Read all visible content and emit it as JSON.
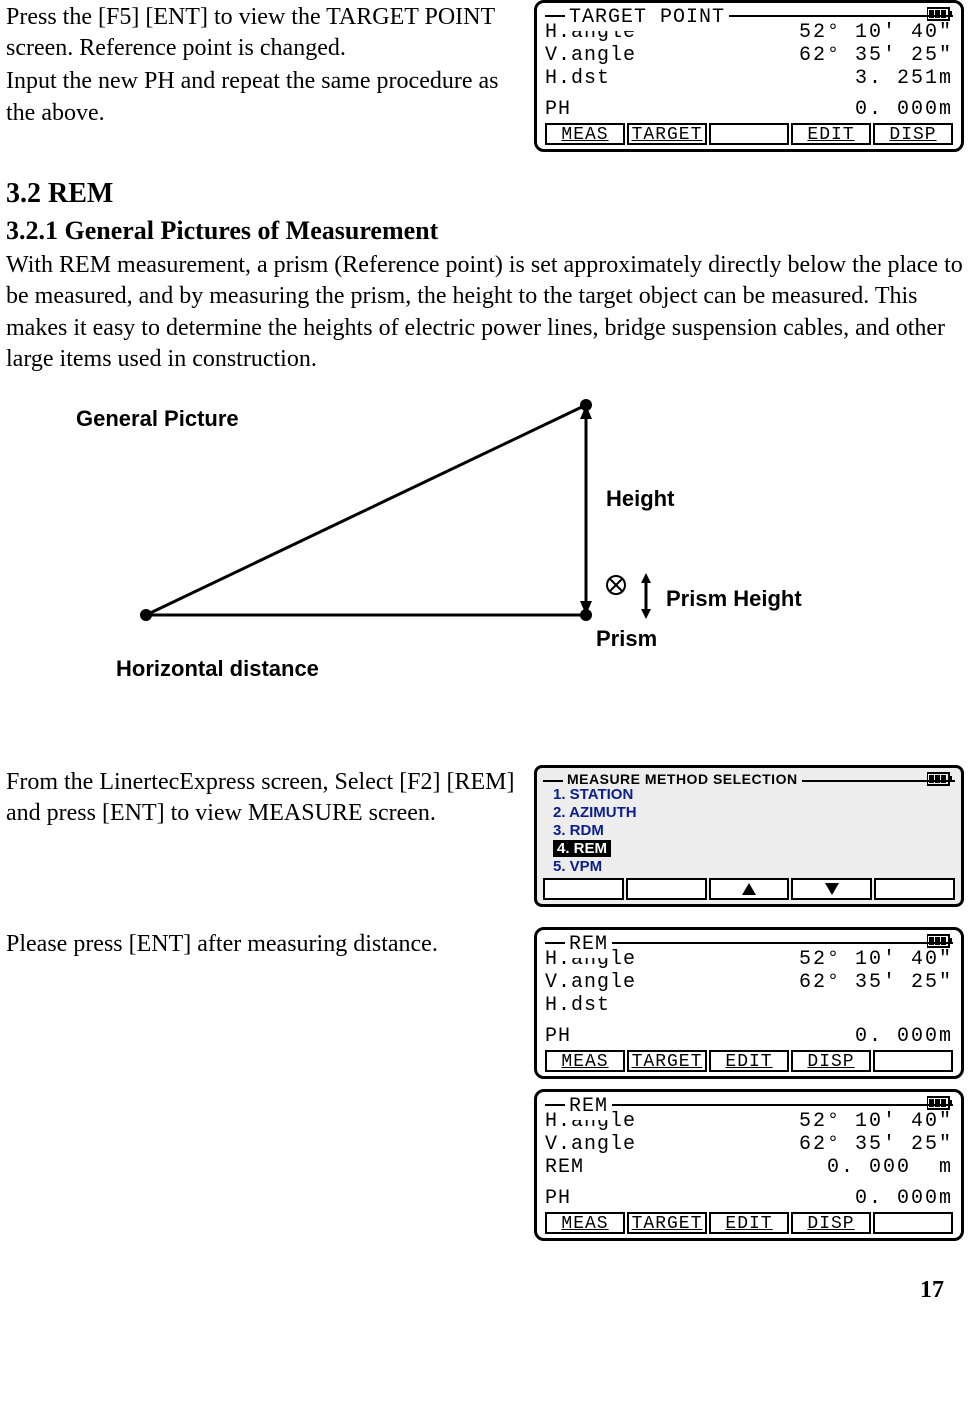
{
  "intro": {
    "para1_line1": "Press the [F5] [ENT] to view the TARGET POINT screen. Reference point is changed.",
    "para1_line2": "Input the new PH and repeat the same procedure as the above."
  },
  "screen_target_point": {
    "title": "TARGET POINT",
    "rows": [
      {
        "label": "H.angle",
        "value": "52° 10′ 40″"
      },
      {
        "label": "V.angle",
        "value": "62° 35′ 25″"
      },
      {
        "label": "H.dst",
        "value": "3. 251m"
      }
    ],
    "ph": {
      "label": "PH",
      "value": "0. 000m"
    },
    "softkeys": [
      "MEAS",
      "TARGET",
      "",
      "EDIT",
      "DISP"
    ]
  },
  "section": {
    "h2": "3.2 REM",
    "h3": "3.2.1 General Pictures of Measurement",
    "body": "With REM measurement, a prism (Reference point) is set approximately directly below the place to be measured, and by measuring the prism, the height to the target object can be measured. This makes it easy to determine the heights of electric power lines, bridge suspension cables, and other large items used in construction."
  },
  "diagram": {
    "title": "General Picture",
    "height_label": "Height",
    "prism_height_label": "Prism Height",
    "prism_label": "Prism",
    "hdist_label": "Horizontal distance"
  },
  "step1_text": "From the LinertecExpress screen, Select [F2] [REM] and press [ENT] to view MEASURE screen.",
  "screen_method": {
    "title": "MEASURE METHOD SELECTION",
    "items": [
      "1. STATION",
      "2. AZIMUTH",
      "3. RDM",
      "4. REM",
      "5. VPM"
    ],
    "selected_index": 3
  },
  "step2_text": "Please press [ENT] after measuring distance.",
  "screen_rem1": {
    "title": "REM",
    "rows": [
      {
        "label": "H.angle",
        "value": "52° 10′ 40″"
      },
      {
        "label": "V.angle",
        "value": "62° 35′ 25″"
      },
      {
        "label": "H.dst",
        "value": ""
      }
    ],
    "ph": {
      "label": "PH",
      "value": "0. 000m"
    },
    "softkeys": [
      "MEAS",
      "TARGET",
      "EDIT",
      "DISP",
      ""
    ]
  },
  "screen_rem2": {
    "title": "REM",
    "rows": [
      {
        "label": "H.angle",
        "value": "52° 10′ 40″"
      },
      {
        "label": "V.angle",
        "value": "62° 35′ 25″"
      },
      {
        "label": "REM",
        "value": "0. 000  m"
      }
    ],
    "ph": {
      "label": "PH",
      "value": "0. 000m"
    },
    "softkeys": [
      "MEAS",
      "TARGET",
      "EDIT",
      "DISP",
      ""
    ]
  },
  "page_number": "17"
}
